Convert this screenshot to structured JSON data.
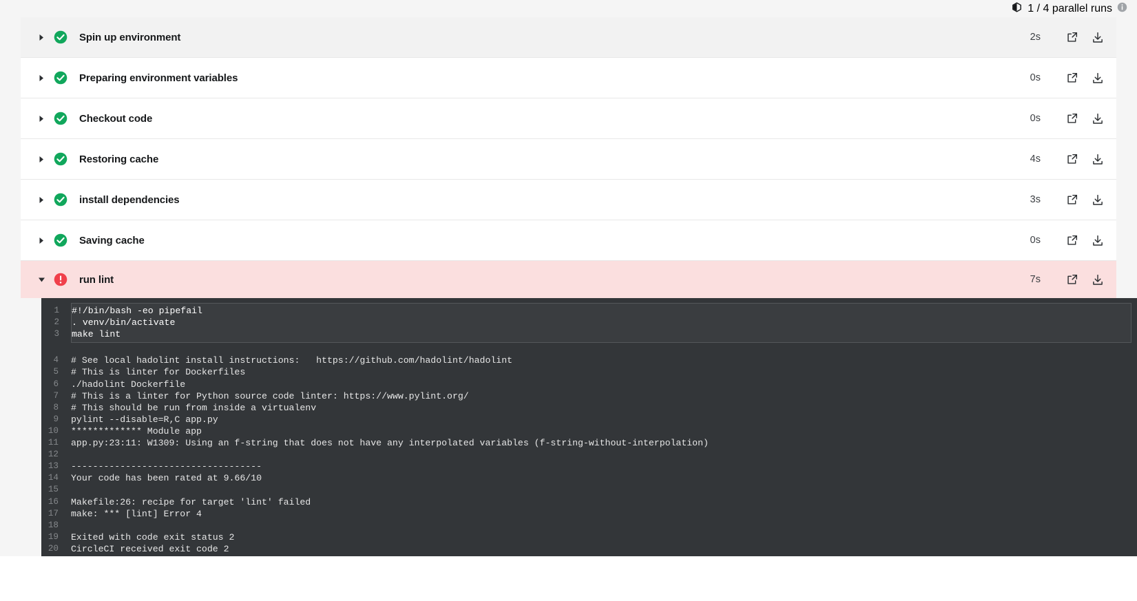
{
  "topbar": {
    "parallel_runs_label": "1 / 4 parallel runs",
    "cube_icon": "cube-icon",
    "info_icon": "info-icon"
  },
  "steps": [
    {
      "name": "Spin up environment",
      "status": "success",
      "duration": "2s",
      "expanded": false
    },
    {
      "name": "Preparing environment variables",
      "status": "success",
      "duration": "0s",
      "expanded": false
    },
    {
      "name": "Checkout code",
      "status": "success",
      "duration": "0s",
      "expanded": false
    },
    {
      "name": "Restoring cache",
      "status": "success",
      "duration": "4s",
      "expanded": false
    },
    {
      "name": "install dependencies",
      "status": "success",
      "duration": "3s",
      "expanded": false
    },
    {
      "name": "Saving cache",
      "status": "success",
      "duration": "0s",
      "expanded": false
    },
    {
      "name": "run lint",
      "status": "failed",
      "duration": "7s",
      "expanded": true
    }
  ],
  "row_actions": {
    "popout_icon": "external-link-icon",
    "download_icon": "download-icon",
    "collapsed_caret_icon": "caret-right-icon",
    "expanded_caret_icon": "caret-down-icon",
    "success_icon": "check-circle-icon",
    "failed_icon": "error-circle-icon"
  },
  "terminal": {
    "command_lines": [
      {
        "n": "1",
        "text": "#!/bin/bash -eo pipefail"
      },
      {
        "n": "2",
        "text": ". venv/bin/activate"
      },
      {
        "n": "3",
        "text": "make lint"
      }
    ],
    "output_lines": [
      {
        "n": "4",
        "text": "# See local hadolint install instructions:   https://github.com/hadolint/hadolint"
      },
      {
        "n": "5",
        "text": "# This is linter for Dockerfiles"
      },
      {
        "n": "6",
        "text": "./hadolint Dockerfile"
      },
      {
        "n": "7",
        "text": "# This is a linter for Python source code linter: https://www.pylint.org/"
      },
      {
        "n": "8",
        "text": "# This should be run from inside a virtualenv"
      },
      {
        "n": "9",
        "text": "pylint --disable=R,C app.py"
      },
      {
        "n": "10",
        "text": "************* Module app"
      },
      {
        "n": "11",
        "text": "app.py:23:11: W1309: Using an f-string that does not have any interpolated variables (f-string-without-interpolation)"
      },
      {
        "n": "12",
        "text": ""
      },
      {
        "n": "13",
        "text": "-----------------------------------"
      },
      {
        "n": "14",
        "text": "Your code has been rated at 9.66/10"
      },
      {
        "n": "15",
        "text": ""
      },
      {
        "n": "16",
        "text": "Makefile:26: recipe for target 'lint' failed"
      },
      {
        "n": "17",
        "text": "make: *** [lint] Error 4"
      },
      {
        "n": "18",
        "text": ""
      },
      {
        "n": "19",
        "text": "Exited with code exit status 2"
      },
      {
        "n": "20",
        "text": "CircleCI received exit code 2"
      }
    ]
  },
  "colors": {
    "success_green": "#11A75C",
    "error_red": "#F0404B",
    "failed_row_bg": "#fbdfdf",
    "terminal_bg": "#333639",
    "page_bg": "#f5f5f5"
  }
}
